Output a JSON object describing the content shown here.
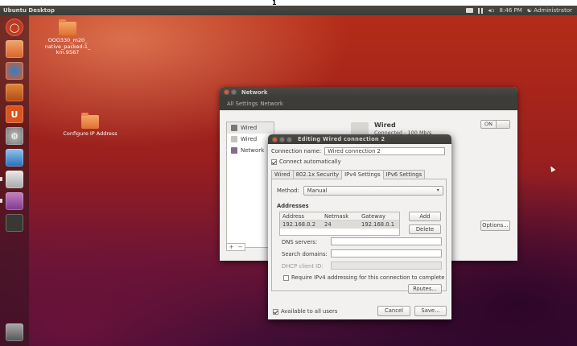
{
  "page_marker": "1",
  "topbar": {
    "title": "Ubuntu Desktop",
    "clock": "8:46 PM",
    "user": "Administrator",
    "volume": "◂▫"
  },
  "desktop": {
    "icons": [
      {
        "label": "OOO330_m20_ native_packed-1_ km.9567",
        "icon": "folder-icon"
      },
      {
        "label": "Configure IP Address",
        "icon": "folder-icon"
      }
    ]
  },
  "launcher": {
    "items": [
      "dash-home",
      "files",
      "firefox",
      "software-center",
      "ubuntu-one",
      "system-settings",
      "thunderbird",
      "libreoffice",
      "network-manager",
      "terminal",
      "trash"
    ]
  },
  "network_window": {
    "title": "Network",
    "toolbar": {
      "all_settings": "All Settings",
      "crumb": "Network"
    },
    "list": [
      {
        "label": "Wired",
        "icon": "wired-icon"
      },
      {
        "label": "Wired",
        "icon": "wired-icon"
      },
      {
        "label": "Network",
        "icon": "proxy-icon"
      }
    ],
    "detail": {
      "title": "Wired",
      "status": "Connected - 100 Mb/s"
    },
    "toggle_label": "ON",
    "options_label": "Options...",
    "add_label": "+",
    "remove_label": "−"
  },
  "edit_dialog": {
    "title": "Editing Wired connection 2",
    "connection_name_label": "Connection name:",
    "connection_name_value": "Wired connection 2",
    "connect_auto_label": "Connect automatically",
    "tabs": [
      "Wired",
      "802.1x Security",
      "IPv4 Settings",
      "IPv6 Settings"
    ],
    "active_tab": "IPv4 Settings",
    "method_label": "Method:",
    "method_value": "Manual",
    "addresses_label": "Addresses",
    "table": {
      "headers": [
        "Address",
        "Netmask",
        "Gateway"
      ],
      "rows": [
        [
          "192.168.0.2",
          "24",
          "192.168.0.1"
        ]
      ]
    },
    "add_label": "Add",
    "delete_label": "Delete",
    "dns_label": "DNS servers:",
    "search_label": "Search domains:",
    "dhcp_label": "DHCP client ID:",
    "require_label": "Require IPv4 addressing for this connection to complete",
    "routes_label": "Routes...",
    "available_label": "Available to all users",
    "cancel_label": "Cancel",
    "save_label": "Save..."
  }
}
